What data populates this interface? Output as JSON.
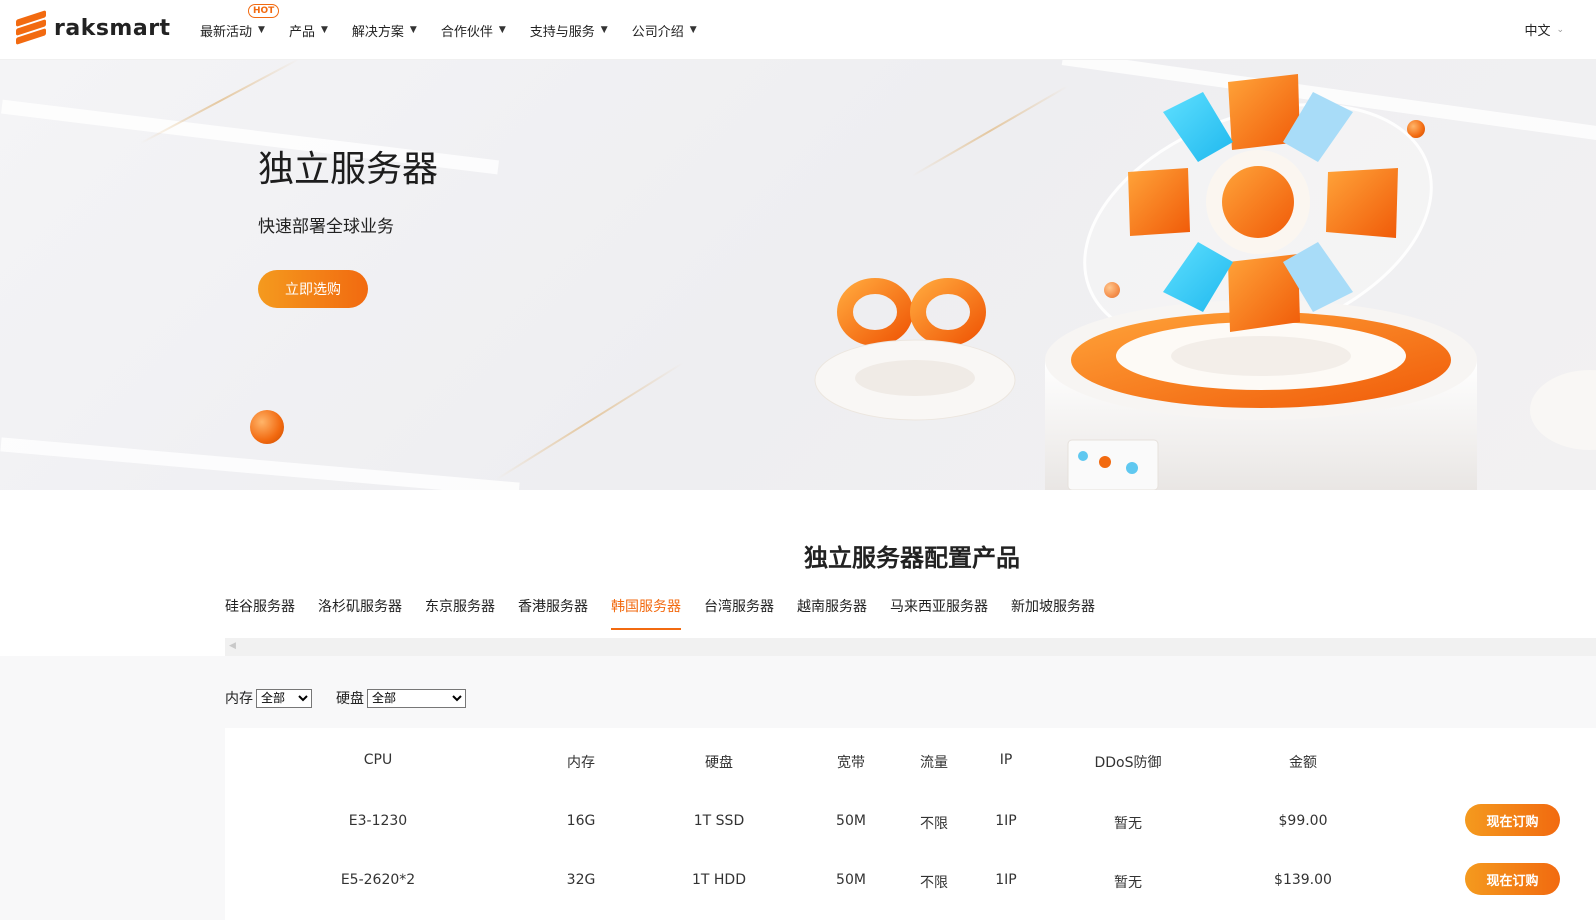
{
  "brand": {
    "name": "raksmart",
    "accent": "#f26a10"
  },
  "nav": {
    "items": [
      {
        "label": "最新活动",
        "hot": "HOT"
      },
      {
        "label": "产品"
      },
      {
        "label": "解决方案"
      },
      {
        "label": "合作伙伴"
      },
      {
        "label": "支持与服务"
      },
      {
        "label": "公司介绍"
      }
    ],
    "language": "中文"
  },
  "hero": {
    "title": "独立服务器",
    "subtitle": "快速部署全球业务",
    "cta": "立即选购"
  },
  "section": {
    "title": "独立服务器配置产品",
    "tabs": [
      "硅谷服务器",
      "洛杉矶服务器",
      "东京服务器",
      "香港服务器",
      "韩国服务器",
      "台湾服务器",
      "越南服务器",
      "马来西亚服务器",
      "新加坡服务器"
    ],
    "active_tab": "韩国服务器"
  },
  "filters": {
    "memory_label": "内存",
    "memory_value": "全部",
    "disk_label": "硬盘",
    "disk_value": "全部"
  },
  "table": {
    "headers": {
      "cpu": "CPU",
      "memory": "内存",
      "disk": "硬盘",
      "bandwidth": "宽带",
      "traffic": "流量",
      "ip": "IP",
      "ddos": "DDoS防御",
      "price": "金额"
    },
    "rows": [
      {
        "cpu": "E3-1230",
        "memory": "16G",
        "disk": "1T SSD",
        "bandwidth": "50M",
        "traffic": "不限",
        "ip": "1IP",
        "ddos": "暂无",
        "price": "$99.00",
        "action": "现在订购"
      },
      {
        "cpu": "E5-2620*2",
        "memory": "32G",
        "disk": "1T HDD",
        "bandwidth": "50M",
        "traffic": "不限",
        "ip": "1IP",
        "ddos": "暂无",
        "price": "$139.00",
        "action": "现在订购"
      }
    ]
  }
}
